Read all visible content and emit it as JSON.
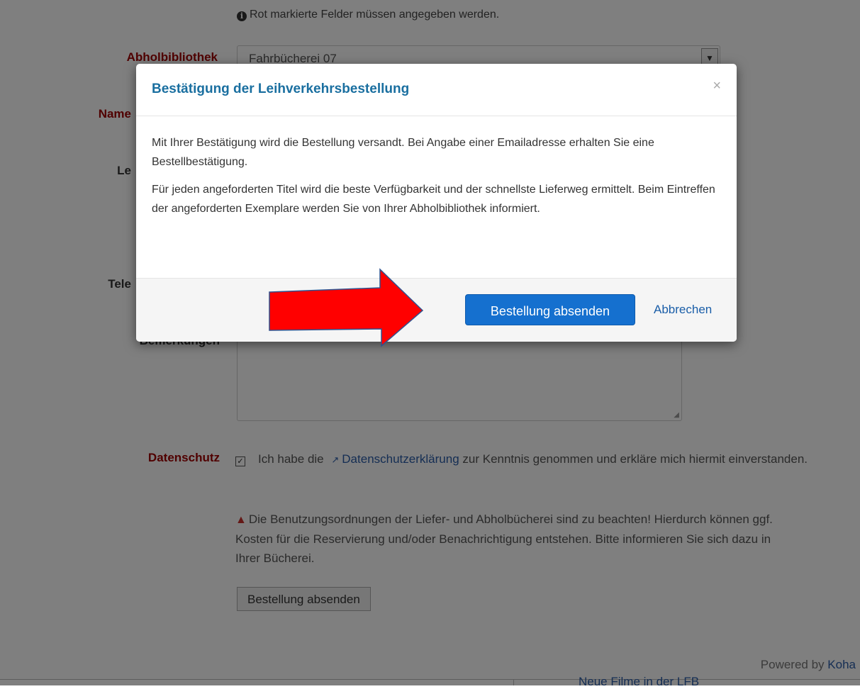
{
  "page": {
    "required_note": "Rot markierte Felder müssen angegeben werden.",
    "labels": {
      "pickup_library": "Abholbibliothek",
      "name": "Name",
      "reader": "Le",
      "phone": "Tele",
      "remarks": "Bemerkungen",
      "privacy": "Datenschutz"
    },
    "pickup_library_value": "Fahrbücherei 07",
    "privacy_text_before": "Ich habe die",
    "privacy_link": "Datenschutzerklärung",
    "privacy_text_after": "zur Kenntnis genommen und erkläre mich hiermit einverstanden.",
    "privacy_checked": true,
    "warning_text": "Die Benutzungsordnungen der Liefer- und Abholbücherei sind zu beachten! Hierdurch können ggf. Kosten für die Reservierung und/oder Benachrichtigung entstehen. Bitte informieren Sie sich dazu in Ihrer Bücherei.",
    "submit_label": "Bestellung absenden",
    "powered_by": "Powered by",
    "powered_brand": "Koha",
    "footer_link": "Neue Filme in der LFB"
  },
  "modal": {
    "title": "Bestätigung der Leihverkehrsbestellung",
    "close_symbol": "×",
    "paragraph1": "Mit Ihrer Bestätigung wird die Bestellung versandt. Bei Angabe einer Emailadresse erhalten Sie eine Bestellbestätigung.",
    "paragraph2": "Für jeden angeforderten Titel wird die beste Verfügbarkeit und der schnellste Lieferweg ermittelt. Beim Eintreffen der angeforderten Exemplare werden Sie von Ihrer Abholbibliothek informiert.",
    "confirm_label": "Bestellung absenden",
    "cancel_label": "Abbrechen"
  },
  "colors": {
    "arrow_fill": "#ff0000",
    "arrow_stroke": "#2f528f",
    "primary_button": "#1570cf",
    "title_color": "#1a6fa0"
  },
  "icons": [
    "info-icon",
    "checkbox-checked-icon",
    "external-link-icon",
    "warning-icon",
    "close-icon",
    "chevron-down-icon",
    "red-arrow-annotation"
  ]
}
